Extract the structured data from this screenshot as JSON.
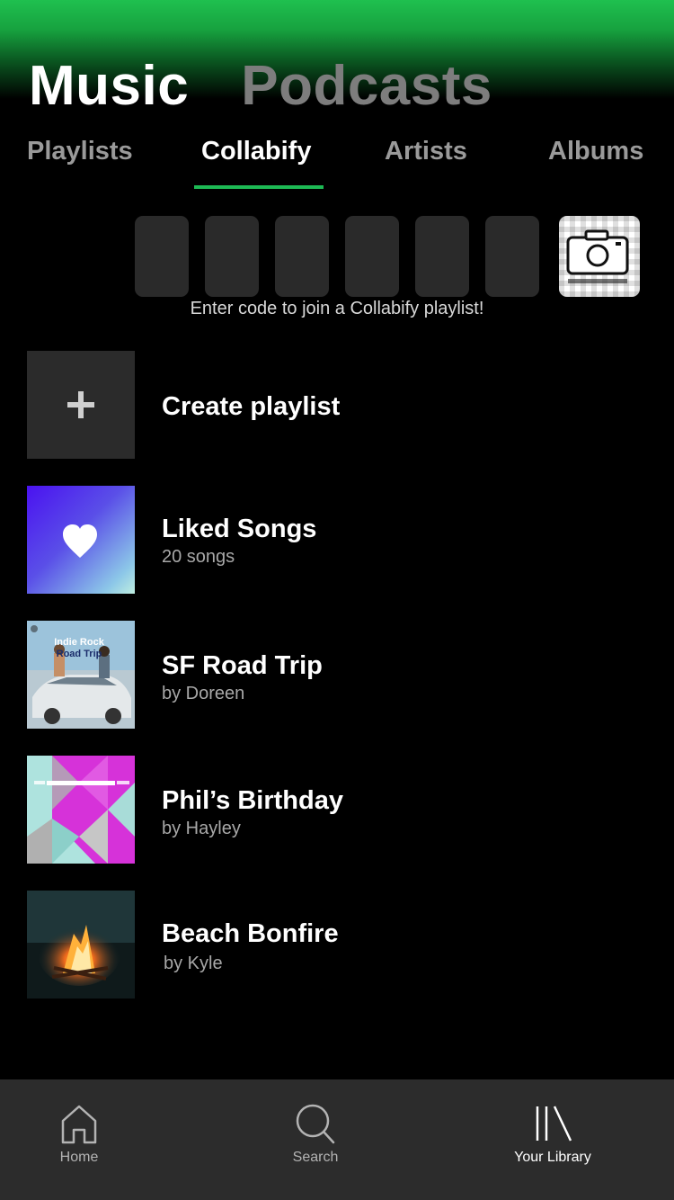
{
  "header": {
    "main_tabs": [
      {
        "label": "Music",
        "active": true
      },
      {
        "label": "Podcasts",
        "active": false
      }
    ],
    "sub_tabs": [
      {
        "label": "Playlists",
        "active": false
      },
      {
        "label": "Collabify",
        "active": true
      },
      {
        "label": "Artists",
        "active": false
      },
      {
        "label": "Albums",
        "active": false
      }
    ]
  },
  "collab_code": {
    "boxes": [
      "",
      "",
      "",
      "",
      "",
      ""
    ],
    "scan_icon": "camera-qr-icon",
    "hint": "Enter code to join a Collabify playlist!"
  },
  "library": {
    "create": {
      "title": "Create playlist",
      "icon": "plus-icon"
    },
    "items": [
      {
        "title": "Liked Songs",
        "subtitle": "20 songs",
        "icon": "heart-icon"
      },
      {
        "title": "SF Road Trip",
        "subtitle": "by Doreen",
        "cover_text": [
          "Indie Rock",
          "Road Trip"
        ]
      },
      {
        "title": "Phil’s Birthday",
        "subtitle": "by Hayley"
      },
      {
        "title": "Beach Bonfire",
        "subtitle": "by Kyle"
      }
    ]
  },
  "nav": {
    "items": [
      {
        "label": "Home",
        "icon": "home-icon",
        "active": false
      },
      {
        "label": "Search",
        "icon": "search-icon",
        "active": false
      },
      {
        "label": "Your Library",
        "icon": "library-icon",
        "active": true
      }
    ]
  },
  "colors": {
    "accent": "#1db954",
    "background": "#000000",
    "nav_background": "#2c2c2c"
  }
}
